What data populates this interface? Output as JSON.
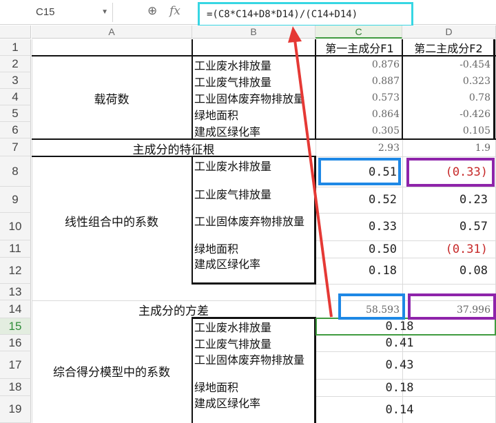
{
  "formula_bar": {
    "cell_ref": "C15",
    "formula": "=(C8*C14+D8*D14)/(C14+D14)"
  },
  "columns": [
    "A",
    "B",
    "C",
    "D"
  ],
  "rows": [
    "1",
    "2",
    "3",
    "4",
    "5",
    "6",
    "7",
    "8",
    "9",
    "10",
    "11",
    "12",
    "13",
    "14",
    "15",
    "16",
    "17",
    "18",
    "19"
  ],
  "header": {
    "c": "第一主成分F1",
    "d": "第二主成分F2"
  },
  "loadings": {
    "label": "载荷数",
    "items": [
      "工业废水排放量",
      "工业废气排放量",
      "工业固体废弃物排放量",
      "绿地面积",
      "建成区绿化率"
    ],
    "c": [
      "0.876",
      "0.887",
      "0.573",
      "0.864",
      "0.305"
    ],
    "d": [
      "-0.454",
      "0.323",
      "0.78",
      "-0.426",
      "0.105"
    ]
  },
  "eigen": {
    "label": "主成分的特征根",
    "c": "2.93",
    "d": "1.9"
  },
  "coef": {
    "label": "线性组合中的系数",
    "items": [
      "工业废水排放量",
      "工业废气排放量",
      "工业固体废弃物排放量",
      "绿地面积",
      "建成区绿化率"
    ],
    "c": [
      "0.51",
      "0.52",
      "0.33",
      "0.50",
      "0.18"
    ],
    "d": [
      "(0.33)",
      "0.23",
      "0.57",
      "(0.31)",
      "0.08"
    ]
  },
  "variance": {
    "label": "主成分的方差",
    "c": "58.593",
    "d": "37.996"
  },
  "score": {
    "label": "综合得分模型中的系数",
    "items": [
      "工业废水排放量",
      "工业废气排放量",
      "工业固体废弃物排放量",
      "绿地面积",
      "建成区绿化率"
    ],
    "values": [
      "0.18",
      "0.41",
      "0.43",
      "0.18",
      "0.14"
    ]
  },
  "colors": {
    "accent_cyan": "#37d6e3",
    "highlight_blue": "#1e88e5",
    "highlight_purple": "#8e24aa",
    "arrow_red": "#e53935",
    "negative_red": "#c62828"
  }
}
